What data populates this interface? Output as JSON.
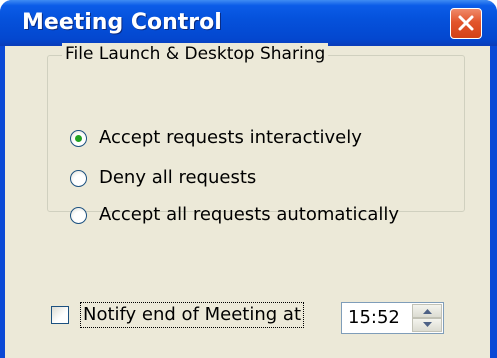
{
  "window": {
    "title": "Meeting Control"
  },
  "group": {
    "legend": "File Launch & Desktop Sharing",
    "options": [
      {
        "label": "Accept requests interactively",
        "selected": true
      },
      {
        "label": "Deny all requests",
        "selected": false
      },
      {
        "label": "Accept all requests automatically",
        "selected": false
      }
    ]
  },
  "notify": {
    "label": "Notify end of Meeting at",
    "checked": false,
    "time": "15:52"
  },
  "icons": {
    "close": "close-icon",
    "spin_up": "spin-up-icon",
    "spin_down": "spin-down-icon"
  },
  "colors": {
    "titlebar": "#0552dc",
    "close_button": "#e2552c",
    "dialog_background": "#ece9d8",
    "radio_selected_dot": "#21a121"
  }
}
